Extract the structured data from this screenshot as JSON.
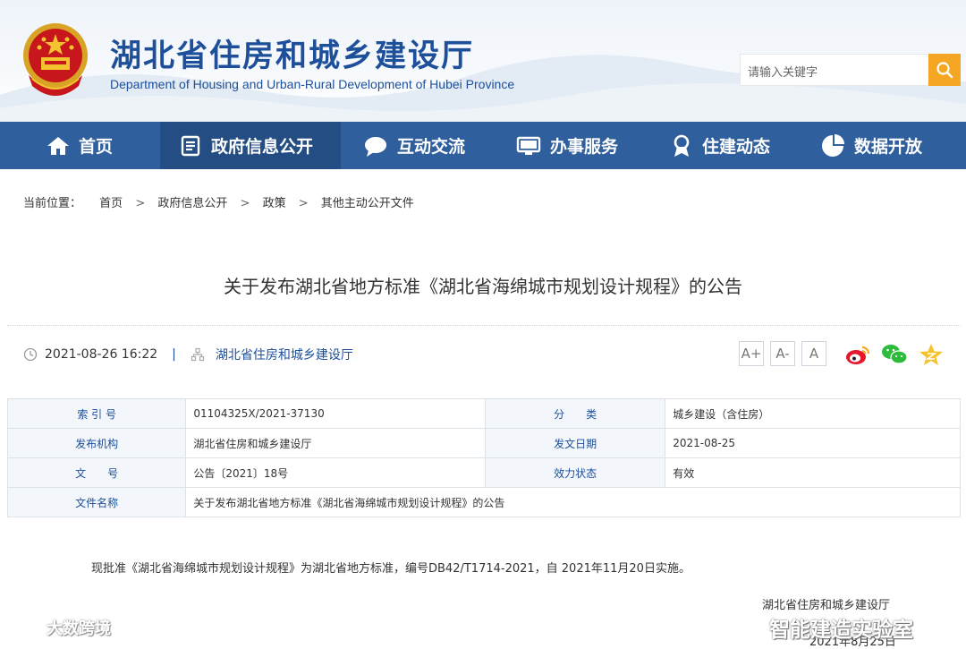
{
  "header": {
    "title": "湖北省住房和城乡建设厅",
    "subtitle": "Department of Housing and Urban-Rural Development of Hubei Province",
    "search_placeholder": "请输入关键字"
  },
  "nav": {
    "items": [
      {
        "label": "首页",
        "icon": "home-icon"
      },
      {
        "label": "政府信息公开",
        "icon": "document-icon",
        "active": true
      },
      {
        "label": "互动交流",
        "icon": "chat-bubble-icon"
      },
      {
        "label": "办事服务",
        "icon": "monitor-icon"
      },
      {
        "label": "住建动态",
        "icon": "ribbon-icon"
      },
      {
        "label": "数据开放",
        "icon": "pie-chart-icon"
      }
    ]
  },
  "breadcrumb": {
    "prefix": "当前位置：",
    "items": [
      "首页",
      "政府信息公开",
      "政策",
      "其他主动公开文件"
    ],
    "separator": ">"
  },
  "article": {
    "title": "关于发布湖北省地方标准《湖北省海绵城市规划设计规程》的公告",
    "datetime": "2021-08-26 16:22",
    "publisher": "湖北省住房和城乡建设厅",
    "font_controls": [
      "A+",
      "A-",
      "A"
    ]
  },
  "info_table": {
    "rows": [
      {
        "k1": "索 引 号",
        "v1": "01104325X/2021-37130",
        "k2": "分　　类",
        "v2": "城乡建设（含住房）"
      },
      {
        "k1": "发布机构",
        "v1": "湖北省住房和城乡建设厅",
        "k2": "发文日期",
        "v2": "2021-08-25"
      },
      {
        "k1": "文　　号",
        "v1": "公告〔2021〕18号",
        "k2": "效力状态",
        "v2": "有效"
      },
      {
        "k1": "文件名称",
        "v1": "关于发布湖北省地方标准《湖北省海绵城市规划设计规程》的公告"
      }
    ]
  },
  "body": {
    "paragraph": "现批准《湖北省海绵城市规划设计规程》为湖北省地方标准，编号DB42/T1714-2021，自 2021年11月20日实施。",
    "sign_org": "湖北省住房和城乡建设厅",
    "sign_date": "2021年8月25日"
  },
  "watermarks": {
    "left": "大数跨境",
    "right": "智能建造实验室"
  },
  "colors": {
    "brand_blue": "#1d4f9a",
    "nav_bg": "#2f5f9c",
    "nav_active": "#244d83",
    "search_orange": "#f5a623"
  }
}
